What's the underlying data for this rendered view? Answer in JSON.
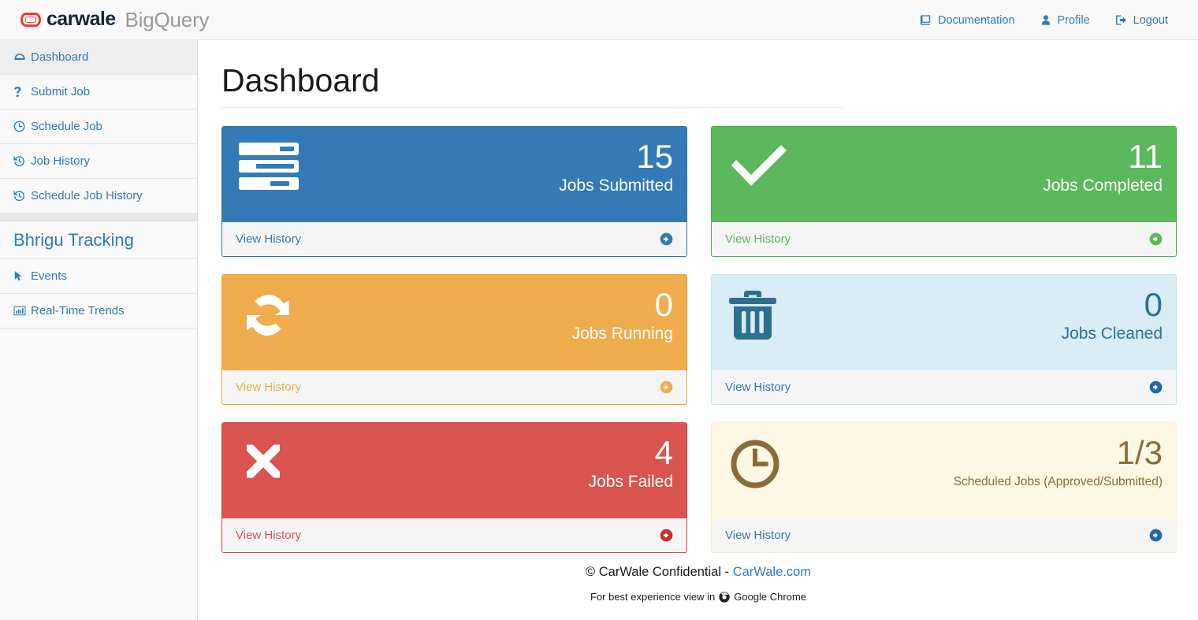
{
  "topnav": {
    "brand_logo_word": "carwale",
    "brand_sub": "BigQuery",
    "logo_color": "#ef3b2d",
    "links": [
      {
        "label": "Documentation",
        "icon": "book-icon"
      },
      {
        "label": "Profile",
        "icon": "user-icon"
      },
      {
        "label": "Logout",
        "icon": "logout-icon"
      }
    ]
  },
  "sidebar": {
    "items": [
      {
        "label": "Dashboard",
        "icon": "dashboard-icon",
        "active": true
      },
      {
        "label": "Submit Job",
        "icon": "question-icon",
        "active": false
      },
      {
        "label": "Schedule Job",
        "icon": "clock-icon",
        "active": false
      },
      {
        "label": "Job History",
        "icon": "history-icon",
        "active": false
      },
      {
        "label": "Schedule Job History",
        "icon": "history-icon",
        "active": false
      }
    ],
    "section_header": "Bhrigu Tracking",
    "section_items": [
      {
        "label": "Events",
        "icon": "cursor-icon"
      },
      {
        "label": "Real-Time Trends",
        "icon": "bar-chart-icon"
      }
    ]
  },
  "main": {
    "page_title": "Dashboard",
    "cards": [
      {
        "id": "jobs-submitted",
        "value": "15",
        "label": "Jobs Submitted",
        "footer_label": "View History",
        "icon": "tasks-icon",
        "color": "#337ab7",
        "theme": "c-blue"
      },
      {
        "id": "jobs-completed",
        "value": "11",
        "label": "Jobs Completed",
        "footer_label": "View History",
        "icon": "check-icon",
        "color": "#5cb85c",
        "theme": "c-green"
      },
      {
        "id": "jobs-running",
        "value": "0",
        "label": "Jobs Running",
        "footer_label": "View History",
        "icon": "refresh-icon",
        "color": "#efad4e",
        "theme": "c-orange"
      },
      {
        "id": "jobs-cleaned",
        "value": "0",
        "label": "Jobs Cleaned",
        "footer_label": "View History",
        "icon": "trash-icon",
        "color": "#d9edf7",
        "theme": "c-info"
      },
      {
        "id": "jobs-failed",
        "value": "4",
        "label": "Jobs Failed",
        "footer_label": "View History",
        "icon": "times-icon",
        "color": "#d9534f",
        "theme": "c-red"
      },
      {
        "id": "scheduled-jobs",
        "value": "1/3",
        "label": "Scheduled Jobs (Approved/Submitted)",
        "footer_label": "View History",
        "icon": "clock-icon",
        "color": "#fcf8e3",
        "theme": "c-warn"
      }
    ]
  },
  "footer": {
    "copyright": "© CarWale Confidential - ",
    "site_link": "CarWale.com",
    "browser_note_prefix": "For best experience view in",
    "browser_name": "Google Chrome",
    "browser_icon": "chrome-icon"
  }
}
